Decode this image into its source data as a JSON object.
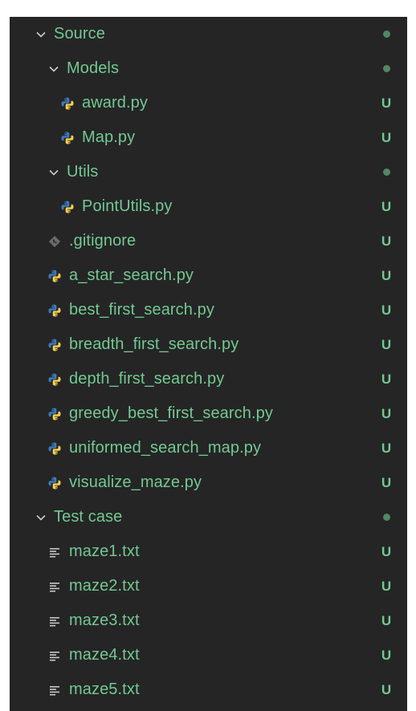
{
  "explorer": {
    "items": [
      {
        "kind": "folder",
        "label": "Source",
        "status": "",
        "icon": "chevron-down-icon"
      },
      {
        "kind": "folder",
        "label": "Models",
        "status": "",
        "icon": "chevron-down-icon"
      },
      {
        "kind": "file",
        "label": "award.py",
        "status": "U",
        "icon": "python-file-icon"
      },
      {
        "kind": "file",
        "label": "Map.py",
        "status": "U",
        "icon": "python-file-icon"
      },
      {
        "kind": "folder",
        "label": "Utils",
        "status": "",
        "icon": "chevron-down-icon"
      },
      {
        "kind": "file",
        "label": "PointUtils.py",
        "status": "U",
        "icon": "python-file-icon"
      },
      {
        "kind": "file",
        "label": ".gitignore",
        "status": "U",
        "icon": "git-file-icon"
      },
      {
        "kind": "file",
        "label": "a_star_search.py",
        "status": "U",
        "icon": "python-file-icon"
      },
      {
        "kind": "file",
        "label": "best_first_search.py",
        "status": "U",
        "icon": "python-file-icon"
      },
      {
        "kind": "file",
        "label": "breadth_first_search.py",
        "status": "U",
        "icon": "python-file-icon"
      },
      {
        "kind": "file",
        "label": "depth_first_search.py",
        "status": "U",
        "icon": "python-file-icon"
      },
      {
        "kind": "file",
        "label": "greedy_best_first_search.py",
        "status": "U",
        "icon": "python-file-icon"
      },
      {
        "kind": "file",
        "label": "uniformed_search_map.py",
        "status": "U",
        "icon": "python-file-icon"
      },
      {
        "kind": "file",
        "label": "visualize_maze.py",
        "status": "U",
        "icon": "python-file-icon"
      },
      {
        "kind": "folder",
        "label": "Test case",
        "status": "",
        "icon": "chevron-down-icon"
      },
      {
        "kind": "file",
        "label": "maze1.txt",
        "status": "U",
        "icon": "text-file-icon"
      },
      {
        "kind": "file",
        "label": "maze2.txt",
        "status": "U",
        "icon": "text-file-icon"
      },
      {
        "kind": "file",
        "label": "maze3.txt",
        "status": "U",
        "icon": "text-file-icon"
      },
      {
        "kind": "file",
        "label": "maze4.txt",
        "status": "U",
        "icon": "text-file-icon"
      },
      {
        "kind": "file",
        "label": "maze5.txt",
        "status": "U",
        "icon": "text-file-icon"
      }
    ]
  },
  "colors": {
    "panel_bg": "#252526",
    "git_untracked": "#73c991",
    "folder_dot": "#5a9a6c",
    "python_blue": "#3b7bbf",
    "python_yellow": "#f5d04c",
    "git_icon_gray": "#8a8a8a",
    "text_icon_gray": "#c8c8c8"
  }
}
